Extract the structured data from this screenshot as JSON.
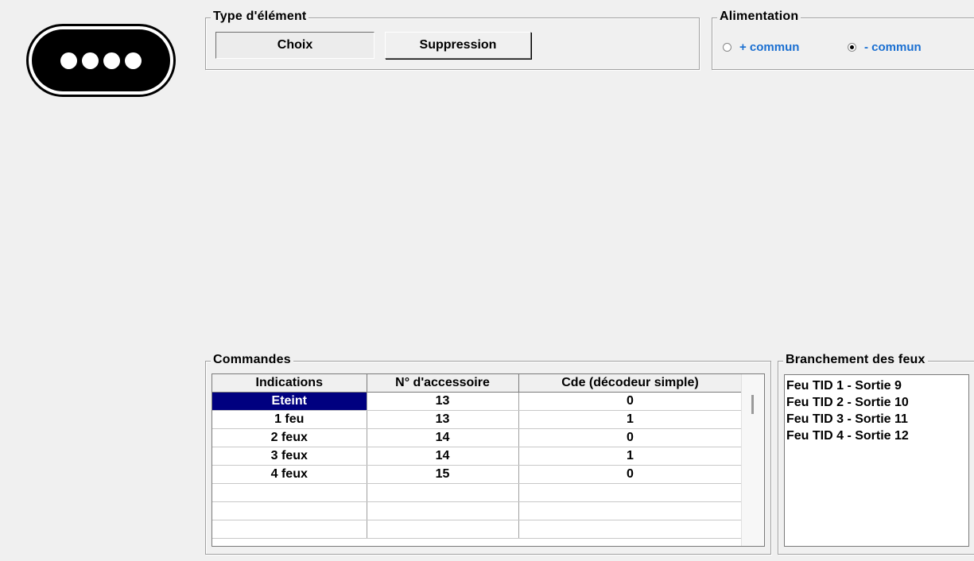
{
  "type_element": {
    "legend": "Type d'élément",
    "choix_label": "Choix",
    "suppression_label": "Suppression"
  },
  "alimentation": {
    "legend": "Alimentation",
    "options": [
      {
        "label": "+ commun",
        "checked": false
      },
      {
        "label": "- commun",
        "checked": true
      }
    ]
  },
  "commandes": {
    "legend": "Commandes",
    "columns": [
      "Indications",
      "N° d'accessoire",
      "Cde (décodeur simple)"
    ],
    "rows": [
      {
        "indication": "Eteint",
        "accessoire": "13",
        "cde": "0",
        "selected": true
      },
      {
        "indication": "1 feu",
        "accessoire": "13",
        "cde": "1"
      },
      {
        "indication": "2 feux",
        "accessoire": "14",
        "cde": "0"
      },
      {
        "indication": "3 feux",
        "accessoire": "14",
        "cde": "1"
      },
      {
        "indication": "4 feux",
        "accessoire": "15",
        "cde": "0"
      },
      {
        "indication": "",
        "accessoire": "",
        "cde": ""
      },
      {
        "indication": "",
        "accessoire": "",
        "cde": ""
      },
      {
        "indication": "",
        "accessoire": "",
        "cde": ""
      }
    ]
  },
  "branchement": {
    "legend": "Branchement des feux",
    "items": [
      "Feu TID 1 - Sortie 9",
      "Feu TID 2 - Sortie 10",
      "Feu TID 3 - Sortie 11",
      "Feu TID 4 - Sortie 12"
    ]
  },
  "signal": {
    "lamps": 4,
    "lamp_color": "#ffffff",
    "body_color": "#000000"
  },
  "colors": {
    "selection": "#000080",
    "radio_text": "#1a6fd1"
  }
}
